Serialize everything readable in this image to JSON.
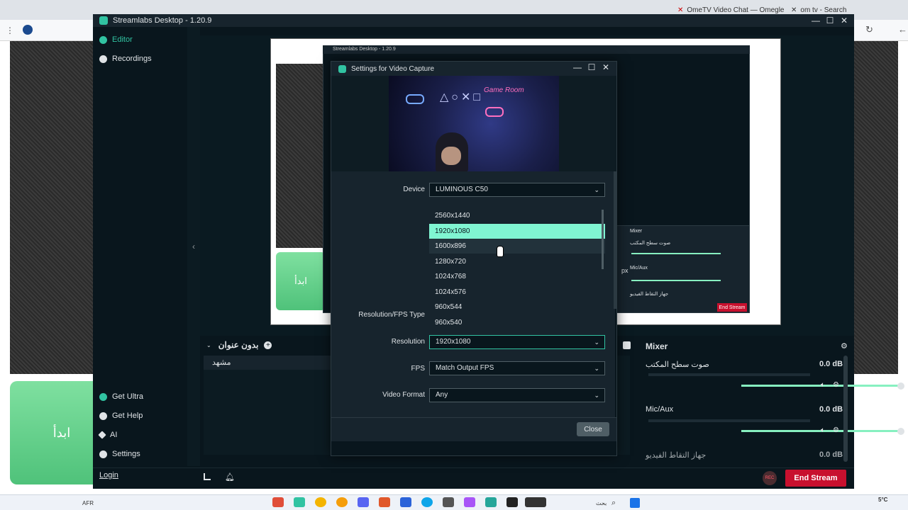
{
  "browser": {
    "tabs": [
      {
        "label": "OmeTV Video Chat — Omegle"
      },
      {
        "label": "om tv - Search"
      }
    ],
    "page_start_button": "ابدأ"
  },
  "app": {
    "title": "Streamlabs Desktop - 1.20.9",
    "nav": {
      "editor": "Editor",
      "recordings": "Recordings",
      "get_ultra": "Get Ultra",
      "get_help": "Get Help",
      "ai": "AI",
      "settings": "Settings",
      "login": "Login"
    },
    "scenes": {
      "collection_name": "بدون عنوان",
      "items": [
        "مشهد"
      ]
    },
    "mixer": {
      "title": "Mixer",
      "channels": [
        {
          "name": "صوت سطح المكتب",
          "db": "0.0 dB",
          "level": 1.0
        },
        {
          "name": "Mic/Aux",
          "db": "0.0 dB",
          "level": 1.0
        },
        {
          "name": "جهاز التقاط الفيديو",
          "db": "0.0 dB",
          "level": 1.0
        }
      ]
    },
    "footer": {
      "end_stream": "End Stream",
      "rec": "REC"
    },
    "nested": {
      "title": "Streamlabs Desktop - 1.20.9",
      "mixer_title": "Mixer",
      "end_stream": "End Stream",
      "px": "px"
    }
  },
  "dialog": {
    "title": "Settings for Video Capture",
    "fields": {
      "device_label": "Device",
      "device_value": "LUMINOUS C50",
      "res_fps_type_label": "Resolution/FPS Type",
      "resolution_label": "Resolution",
      "resolution_value": "1920x1080",
      "fps_label": "FPS",
      "fps_value": "Match Output FPS",
      "video_format_label": "Video Format",
      "video_format_value": "Any"
    },
    "resolution_options": [
      "2560x1440",
      "1920x1080",
      "1600x896",
      "1280x720",
      "1024x768",
      "1024x576",
      "960x544",
      "960x540"
    ],
    "selected_option": "1920x1080",
    "close_label": "Close"
  },
  "taskbar": {
    "weather_temp": "5°C",
    "lang": "AFR",
    "search": "بحث"
  },
  "colors": {
    "accent": "#31c3a2",
    "selected_option": "#80f5d2",
    "end_stream": "#c8102e",
    "app_bg": "#09161d",
    "panel_bg": "#17242d"
  }
}
